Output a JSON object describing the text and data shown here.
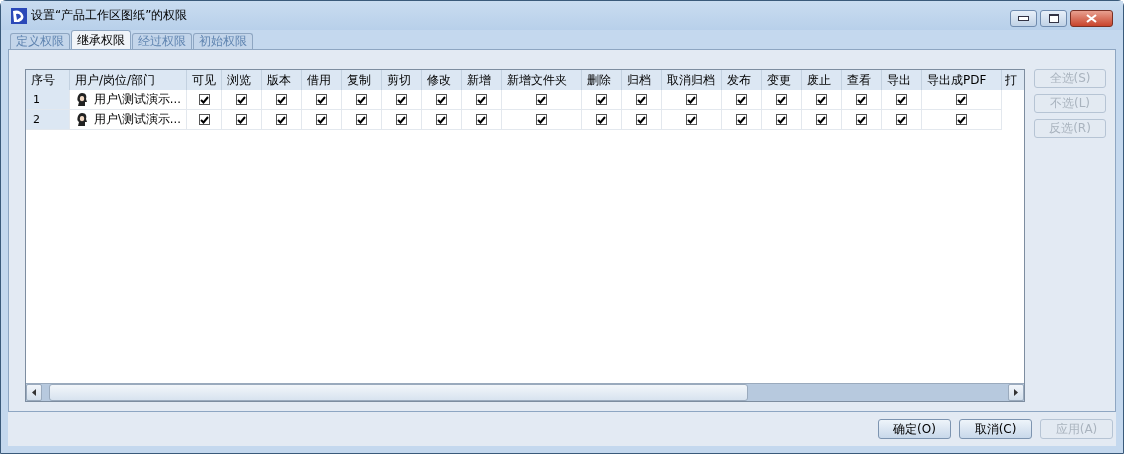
{
  "window": {
    "title": "设置“产品工作区图纸”的权限"
  },
  "tabs": [
    {
      "label": "定义权限",
      "selected": false
    },
    {
      "label": "继承权限",
      "selected": true
    },
    {
      "label": "经过权限",
      "selected": false
    },
    {
      "label": "初始权限",
      "selected": false
    }
  ],
  "table": {
    "columns": [
      "序号",
      "用户/岗位/部门",
      "可见",
      "浏览",
      "版本",
      "借用",
      "复制",
      "剪切",
      "修改",
      "新增",
      "新增文件夹",
      "删除",
      "归档",
      "取消归档",
      "发布",
      "变更",
      "废止",
      "查看",
      "导出",
      "导出成PDF",
      "打"
    ],
    "rows": [
      {
        "index": "1",
        "user": "用户\\测试演示...",
        "checks": [
          true,
          true,
          true,
          true,
          true,
          true,
          true,
          true,
          true,
          true,
          true,
          true,
          true,
          true,
          true,
          true,
          true,
          true
        ]
      },
      {
        "index": "2",
        "user": "用户\\测试演示...",
        "checks": [
          true,
          true,
          true,
          true,
          true,
          true,
          true,
          true,
          true,
          true,
          true,
          true,
          true,
          true,
          true,
          true,
          true,
          true
        ]
      }
    ]
  },
  "side_buttons": [
    {
      "label": "全选(S)",
      "disabled": true
    },
    {
      "label": "不选(L)",
      "disabled": true
    },
    {
      "label": "反选(R)",
      "disabled": true
    }
  ],
  "buttons": [
    {
      "label": "确定(O)",
      "disabled": false
    },
    {
      "label": "取消(C)",
      "disabled": false
    },
    {
      "label": "应用(A)",
      "disabled": true
    }
  ]
}
